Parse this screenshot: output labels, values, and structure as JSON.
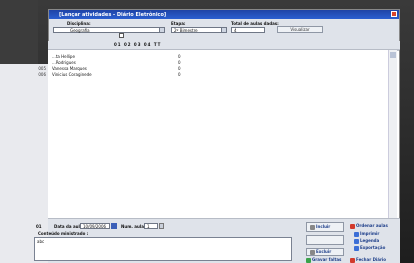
{
  "window": {
    "title": "[Lançar atividades - Diário Eletrônico]"
  },
  "filters": {
    "disciplina_label": "Disciplina:",
    "disciplina_value": "Geografia",
    "etapa_label": "Etapa:",
    "etapa_value": "2º Bimestre",
    "total_label": "Total de aulas dadas:",
    "total_value": "4",
    "left_btn": "Limpar",
    "right_btn": "Visualizar"
  },
  "options": {
    "show_all_label": "Visualizar todos alunos",
    "legend": [
      "Transf.",
      "Rem. p/",
      "Rem. de",
      "Canc.",
      "Evad.",
      "Trans. Disp.",
      "Nao Informado"
    ]
  },
  "grid": {
    "columns_header": "01 02 03 04 TT",
    "rows": [
      {
        "num": "",
        "name": "...ta Hellipe",
        "value": "0"
      },
      {
        "num": "",
        "name": "...Rodrigues",
        "value": "0"
      },
      {
        "num": "005",
        "name": "Vanessa Marques",
        "value": "0"
      },
      {
        "num": "006",
        "name": "Vinicius Coraginede",
        "value": "0"
      }
    ]
  },
  "lesson": {
    "number": "01",
    "date_label": "Data da aula:",
    "date_value": "10/09/2006",
    "num_label": "Num. aula :",
    "num_value": "1",
    "content_label": "Conteúdo ministrado :",
    "content_value": "abc"
  },
  "actions": {
    "incluir": "Incluir",
    "excluir": "Excluir",
    "ordenar": "Ordenar aulas",
    "imprimir": "Imprimir",
    "legenda": "Legenda",
    "exportacao": "Exportação",
    "gravar": "Gravar faltas",
    "fechar": "Fechar Diário"
  }
}
